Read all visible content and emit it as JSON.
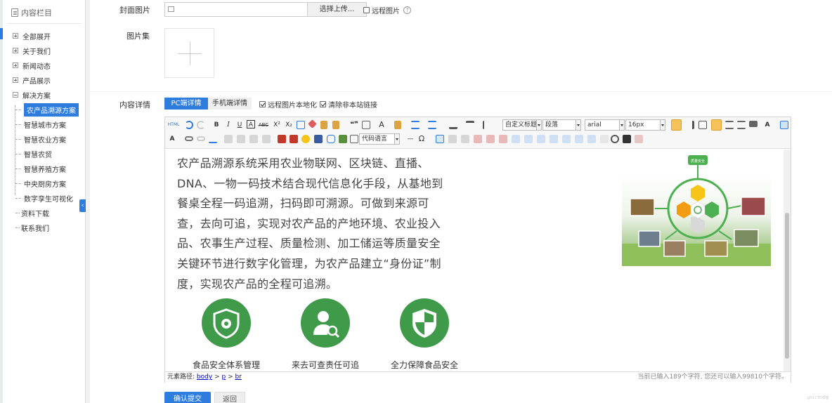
{
  "sidebar": {
    "title": "内容栏目",
    "items": [
      {
        "label": "全部展开",
        "icon": "plus"
      },
      {
        "label": "关于我们",
        "icon": "plus"
      },
      {
        "label": "新闻动态",
        "icon": "plus"
      },
      {
        "label": "产品展示",
        "icon": "plus"
      },
      {
        "label": "解决方案",
        "icon": "minus"
      }
    ],
    "children": [
      {
        "label": "农产品溯源方案",
        "selected": true
      },
      {
        "label": "智慧城市方案"
      },
      {
        "label": "智慧农业方案"
      },
      {
        "label": "智慧农贸"
      },
      {
        "label": "智慧养殖方案"
      },
      {
        "label": "中央厨房方案"
      },
      {
        "label": "数字孪生可视化"
      }
    ],
    "bottom_items": [
      {
        "label": "资料下载"
      },
      {
        "label": "联系我们"
      }
    ],
    "collapse_glyph": "‹"
  },
  "form": {
    "cover_label": "封面图片",
    "cover_button": "选择上传...",
    "remote_image_label": "远程图片",
    "help_glyph": "?",
    "gallery_label": "图片集",
    "detail_label": "内容详情",
    "tab_pc": "PC端详情",
    "tab_mobile": "手机端详情",
    "opt_localize": "远程图片本地化",
    "opt_clear_links": "清除非本站链接",
    "submit_label": "确认提交",
    "back_label": "返回"
  },
  "editor": {
    "toolbar": {
      "html_label": "HTML",
      "bold": "B",
      "italic": "I",
      "underline": "U",
      "border": "A",
      "strike": "ABC",
      "sup": "X²",
      "sub": "X₂",
      "quote": "❝❞",
      "font_color": "A",
      "format_select": "自定义标题",
      "paragraph_select": "段落",
      "font_select": "arial",
      "size_select": "16px",
      "code_lang_select": "代码语言",
      "omega": "Ω",
      "dash": "—"
    },
    "body_text": "农产品溯源系统采用农业物联网、区块链、直播、DNA、一物一码技术结合现代信息化手段，从基地到餐桌全程一码追溯，扫码即可溯源。可做到来源可查，去向可追，实现对农产品的产地环境、农业投入品、农事生产过程、质量检测、加工储运等质量安全关键环节进行数字化管理，为农产品建立“身份证”制度，实现农产品的全程可追溯。",
    "diagram_top_label": "质量安全",
    "features": [
      {
        "icon": "shield-gear-icon",
        "label": "食品安全体系管理"
      },
      {
        "icon": "person-search-icon",
        "label": "来去可查责任可追"
      },
      {
        "icon": "shield-icon",
        "label": "全力保障食品安全"
      }
    ],
    "status_path_label": "元素路径:",
    "status_path": [
      "body",
      "p",
      "br"
    ],
    "status_path_sep": ">",
    "status_count": "当前已输入189个字符, 您还可以输入99810个字符。"
  },
  "colors": {
    "accent": "#2e7cdd",
    "feature_green": "#3f9b4a",
    "diagram_green": "#4caf50",
    "diagram_yellow": "#f5c518",
    "diagram_orange": "#f39c12"
  },
  "watermark": "@51CTO博客"
}
